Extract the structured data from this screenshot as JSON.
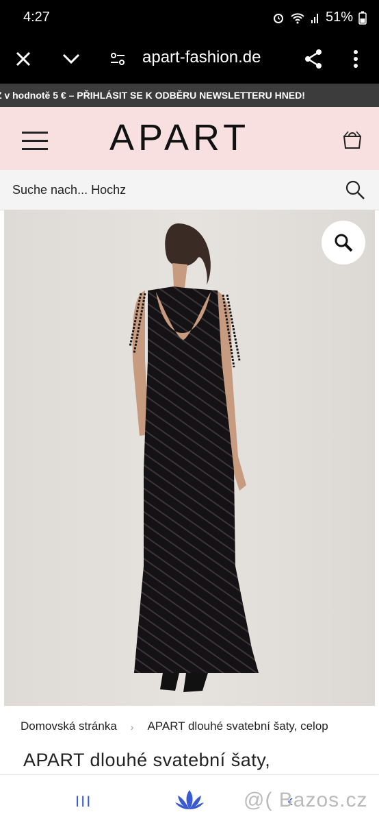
{
  "status": {
    "time": "4:27",
    "battery": "51%"
  },
  "browser": {
    "url": "apart-fashion.de"
  },
  "promo": {
    "text": "Z v hodnotě 5 € – PŘIHLÁSIT SE K ODBĚRU NEWSLETTERU HNED!"
  },
  "header": {
    "logo": "APART"
  },
  "search": {
    "value": "Suche nach... Hochz"
  },
  "breadcrumb": {
    "home": "Domovská stránka",
    "separator": "›",
    "current": "APART dlouhé svatební šaty, celop"
  },
  "product": {
    "title": "APART dlouhé svatební šaty,"
  },
  "watermark": {
    "text": "@( Bazos.cz"
  },
  "nav": {
    "recents": "III"
  },
  "colors": {
    "header_bg": "#f8dfe0",
    "accent": "#3a5bd0",
    "toolbar": "#000000"
  }
}
